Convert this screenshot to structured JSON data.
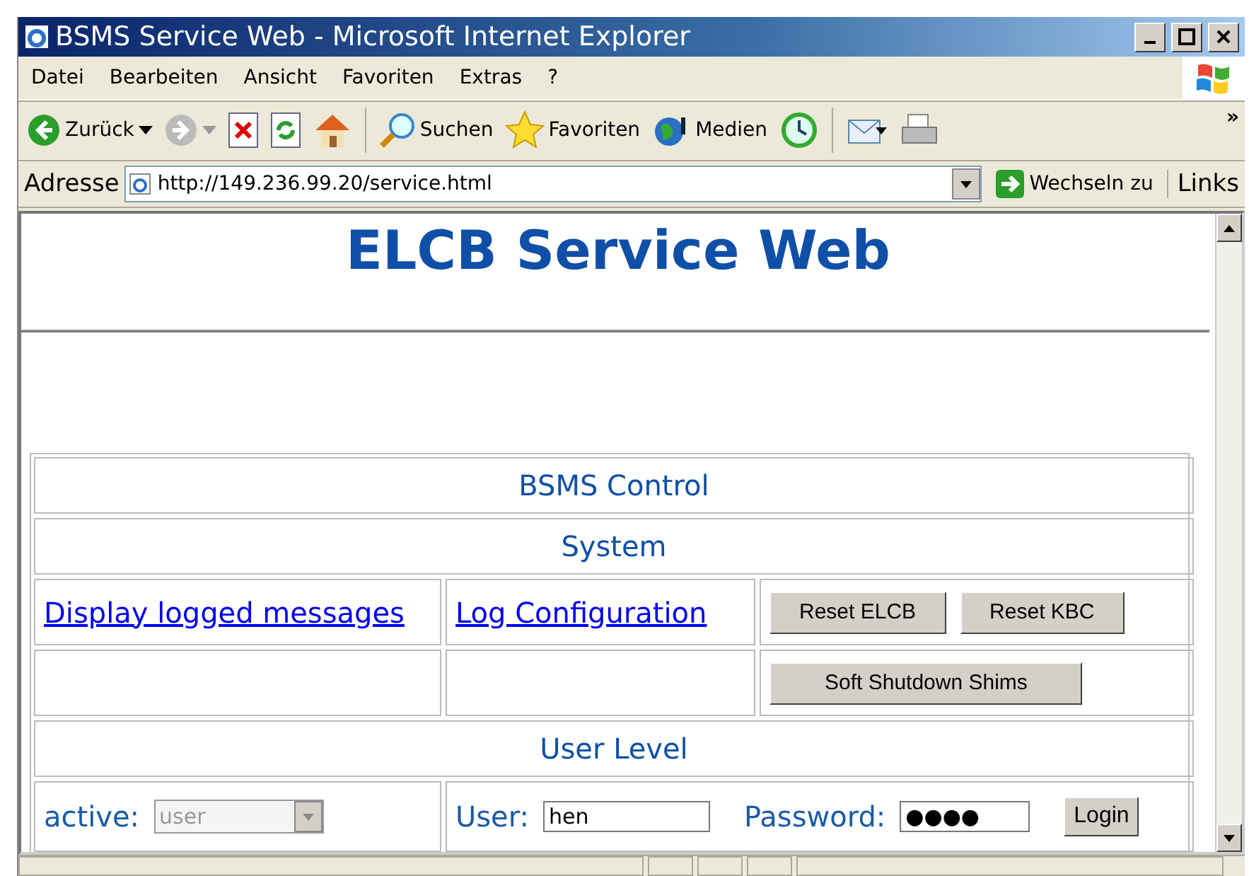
{
  "window": {
    "title": "BSMS Service Web - Microsoft Internet Explorer"
  },
  "menu": [
    "Datei",
    "Bearbeiten",
    "Ansicht",
    "Favoriten",
    "Extras",
    "?"
  ],
  "toolbar": [
    {
      "kind": "back",
      "label": "Zurück",
      "disabled": false
    },
    {
      "kind": "forward",
      "disabled": true
    },
    {
      "kind": "stop"
    },
    {
      "kind": "refresh"
    },
    {
      "kind": "home"
    },
    {
      "kind": "sep"
    },
    {
      "kind": "search",
      "label": "Suchen"
    },
    {
      "kind": "favorites",
      "label": "Favoriten"
    },
    {
      "kind": "media",
      "label": "Medien"
    },
    {
      "kind": "history"
    },
    {
      "kind": "sep"
    },
    {
      "kind": "mail"
    },
    {
      "kind": "print"
    }
  ],
  "toolbar_more": "»",
  "address": {
    "label": "Adresse",
    "value": "http://149.236.99.20/service.html",
    "go": "Wechseln zu",
    "links": "Links"
  },
  "page": {
    "heading": "ELCB Service Web",
    "sections": [
      {
        "title": "BSMS Control"
      },
      {
        "title": "System"
      }
    ],
    "links": [
      "Display logged messages",
      "Log Configuration"
    ],
    "buttons": [
      "Reset ELCB",
      "Reset KBC"
    ],
    "shutdown_button": "Soft Shutdown Shims",
    "user_level": {
      "title": "User Level",
      "active_label": "active:",
      "active_value": "user",
      "active_disabled": true,
      "user_label": "User:",
      "user_value": "hen",
      "password_label": "Password:",
      "password_value": "●●●●",
      "login": "Login"
    }
  }
}
